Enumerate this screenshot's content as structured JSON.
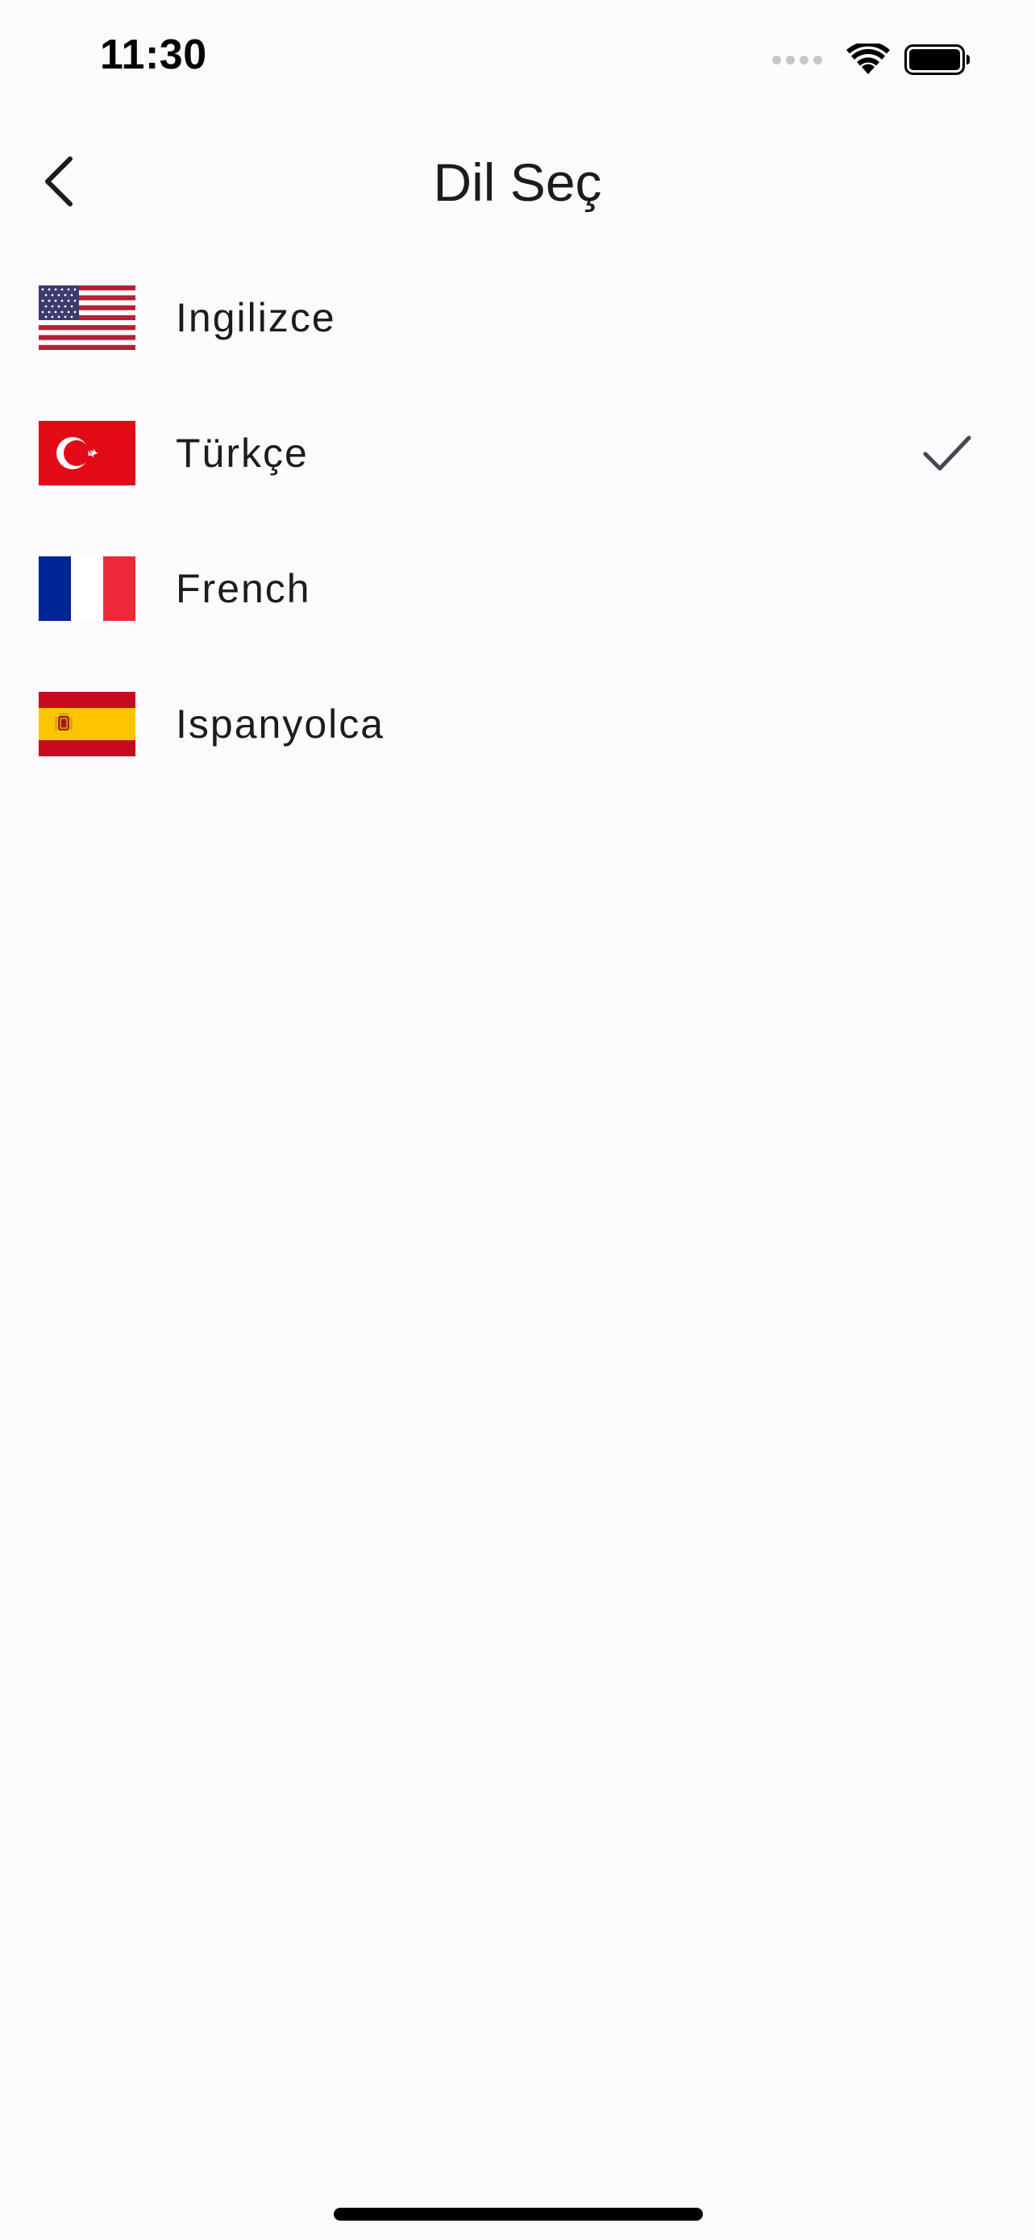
{
  "status_bar": {
    "time": "11:30"
  },
  "header": {
    "title": "Dil Seç",
    "back_icon": "chevron-left-icon"
  },
  "languages": [
    {
      "label": "Ingilizce",
      "flag": "us-flag-icon",
      "selected": false
    },
    {
      "label": "Türkçe",
      "flag": "turkey-flag-icon",
      "selected": true
    },
    {
      "label": "French",
      "flag": "france-flag-icon",
      "selected": false
    },
    {
      "label": "Ispanyolca",
      "flag": "spain-flag-icon",
      "selected": false
    }
  ],
  "colors": {
    "background": "#fdfbfd",
    "text": "#1d1b20",
    "check": "#49454f"
  }
}
